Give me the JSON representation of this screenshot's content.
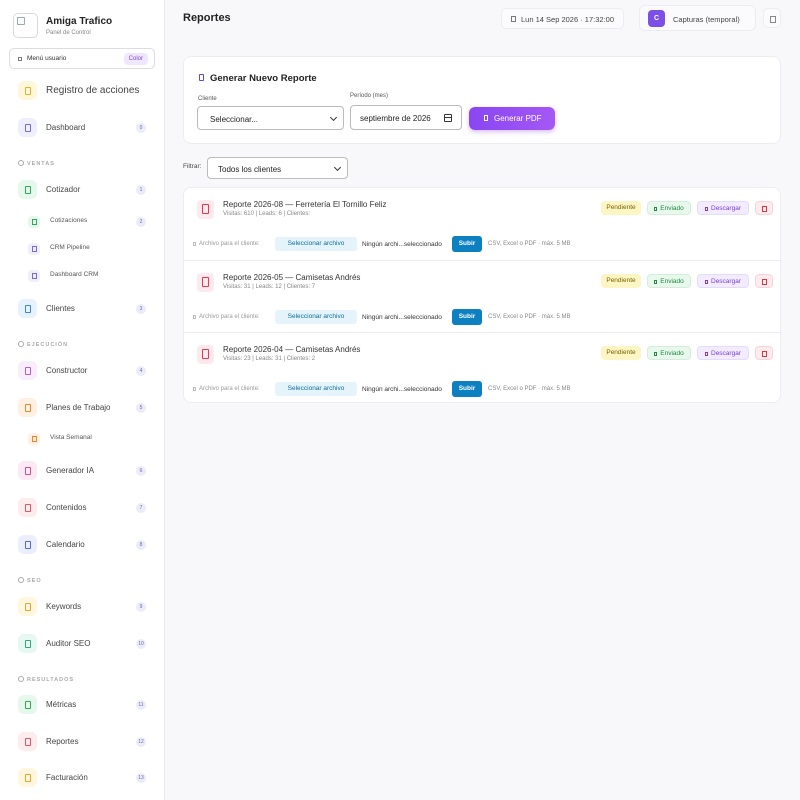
{
  "brand": {
    "title": "Amiga Trafico",
    "subtitle": "Panel de Control"
  },
  "menu_toggle": {
    "label": "Menú usuario",
    "color_label": "Color"
  },
  "nav": {
    "registro": {
      "label": "Registro de acciones"
    },
    "dashboard": {
      "label": "Dashboard",
      "badge": "0"
    },
    "ventas_title": "VENTAS",
    "cotizador": {
      "label": "Cotizador",
      "badge": "1"
    },
    "cotizaciones": {
      "label": "Cotizaciones",
      "badge": "2"
    },
    "crm_pipeline": {
      "label": "CRM Pipeline"
    },
    "dashboard_crm": {
      "label": "Dashboard CRM"
    },
    "clientes": {
      "label": "Clientes",
      "badge": "3"
    },
    "ejecucion_title": "EJECUCIÓN",
    "constructor": {
      "label": "Constructor",
      "badge": "4"
    },
    "planes": {
      "label": "Planes de Trabajo",
      "badge": "5"
    },
    "vista_semanal": {
      "label": "Vista Semanal"
    },
    "generador": {
      "label": "Generador IA",
      "badge": "6"
    },
    "contenidos": {
      "label": "Contenidos",
      "badge": "7"
    },
    "calendario": {
      "label": "Calendario",
      "badge": "8"
    },
    "seo_title": "SEO",
    "keywords": {
      "label": "Keywords",
      "badge": "9"
    },
    "auditor": {
      "label": "Auditor SEO",
      "badge": "10"
    },
    "resultados_title": "RESULTADOS",
    "metricas": {
      "label": "Métricas",
      "badge": "11"
    },
    "reportes": {
      "label": "Reportes",
      "badge": "12"
    },
    "facturacion": {
      "label": "Facturación",
      "badge": "13"
    }
  },
  "header": {
    "title": "Reportes",
    "datetime": "Lun 14 Sep 2026 · 17:32:00",
    "avatar_letter": "C",
    "user_name": "Capturas (temporal)"
  },
  "generar": {
    "title": "Generar Nuevo Reporte",
    "cliente_label": "Cliente",
    "cliente_value": "Seleccionar...",
    "periodo_label": "Período (mes)",
    "periodo_value": "septiembre de 2026",
    "button_label": "Generar PDF"
  },
  "filter": {
    "label": "Filtrar:",
    "value": "Todos los clientes"
  },
  "reports": [
    {
      "title": "Reporte 2026-08 — Ferretería El Tornillo Feliz",
      "meta": "Visitas: 610 | Leads: 6 | Clientes:"
    },
    {
      "title": "Reporte 2026-05 — Camisetas Andrés",
      "meta": "Visitas: 31 | Leads: 12 | Clientes: 7"
    },
    {
      "title": "Reporte 2026-04 — Camisetas Andrés",
      "meta": "Visitas: 23 | Leads: 31 | Clientes: 2"
    }
  ],
  "report_actions": {
    "status": "Pendiente",
    "sent": "Enviado",
    "download": "Descargar",
    "upload_label": "Archivo para el cliente:",
    "select_file": "Seleccionar archivo",
    "no_file": "Ningún archi...seleccionado",
    "upload_button": "Subir",
    "hint": "CSV, Excel o PDF · máx. 5 MB"
  },
  "colors": {
    "accent": "#8a46f2",
    "upload_blue": "#0d80c2",
    "pending_bg": "#fdf5c4",
    "sent_bg": "#e8f8ec",
    "download_bg": "#f3ebff",
    "delete_bg": "#fdebee"
  },
  "icons": {
    "report": "file-pdf-icon",
    "generate": "document-icon",
    "calendar": "calendar-icon",
    "clock": "clock-icon"
  }
}
